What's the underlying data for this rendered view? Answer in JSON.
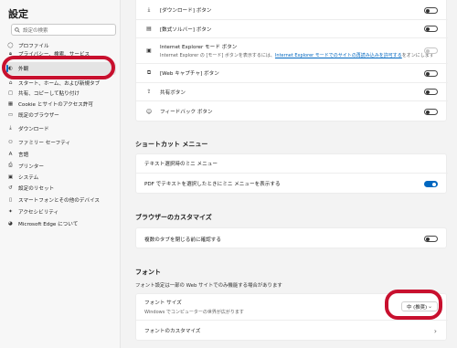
{
  "sidebar": {
    "title": "設定",
    "search_placeholder": "設定の検索",
    "items": [
      {
        "label": "プロファイル",
        "icon": "profile-icon"
      },
      {
        "label": "プライバシー、検索、サービス",
        "icon": "lock-icon"
      },
      {
        "label": "外観",
        "icon": "appearance-icon"
      },
      {
        "label": "スタート、ホーム、および新規タブ",
        "icon": "home-icon"
      },
      {
        "label": "共有、コピーして貼り付け",
        "icon": "share-icon"
      },
      {
        "label": "Cookie とサイトのアクセス許可",
        "icon": "cookie-icon"
      },
      {
        "label": "既定のブラウザー",
        "icon": "browser-icon"
      },
      {
        "label": "ダウンロード",
        "icon": "download-icon"
      },
      {
        "label": "ファミリー セーフティ",
        "icon": "family-icon"
      },
      {
        "label": "言語",
        "icon": "language-icon"
      },
      {
        "label": "プリンター",
        "icon": "printer-icon"
      },
      {
        "label": "システム",
        "icon": "system-icon"
      },
      {
        "label": "設定のリセット",
        "icon": "reset-icon"
      },
      {
        "label": "スマートフォンとその他のデバイス",
        "icon": "phone-icon"
      },
      {
        "label": "アクセシビリティ",
        "icon": "accessibility-icon"
      },
      {
        "label": "Microsoft Edge について",
        "icon": "edge-icon"
      }
    ]
  },
  "toolbar_buttons": {
    "download": "[ダウンロード] ボタン",
    "math": "[数式ソルバー] ボタン",
    "ie_mode": "Internet Explorer モード ボタン",
    "ie_sub_prefix": "Internet Explorer の [モード] ボタンを表示するには、",
    "ie_sub_link": "Internet Explorer モードでのサイトの再読み込みを許可する",
    "ie_sub_suffix": "をオンにします",
    "capture": "[Web キャプチャ] ボタン",
    "share": "共有ボタン",
    "feedback": "フィードバック ボタン"
  },
  "shortcut_menu": {
    "title": "ショートカット メニュー",
    "mini_menu": "テキスト選択時のミニ メニュー",
    "pdf_mini_menu": "PDF でテキストを選択したときにミニ メニューを表示する"
  },
  "browser_custom": {
    "title": "ブラウザーのカスタマイズ",
    "confirm_close": "複数のタブを閉じる前に確認する"
  },
  "fonts": {
    "title": "フォント",
    "note": "フォント設定は一部の Web サイトでのみ機能する場合があります",
    "size_label": "フォント サイズ",
    "size_sub": "Windows でコンピューターの世界が広がります",
    "size_value": "中 (推奨)",
    "customize": "フォントのカスタマイズ"
  },
  "colors": {
    "accent": "#0067c0",
    "highlight": "#c8102e"
  }
}
